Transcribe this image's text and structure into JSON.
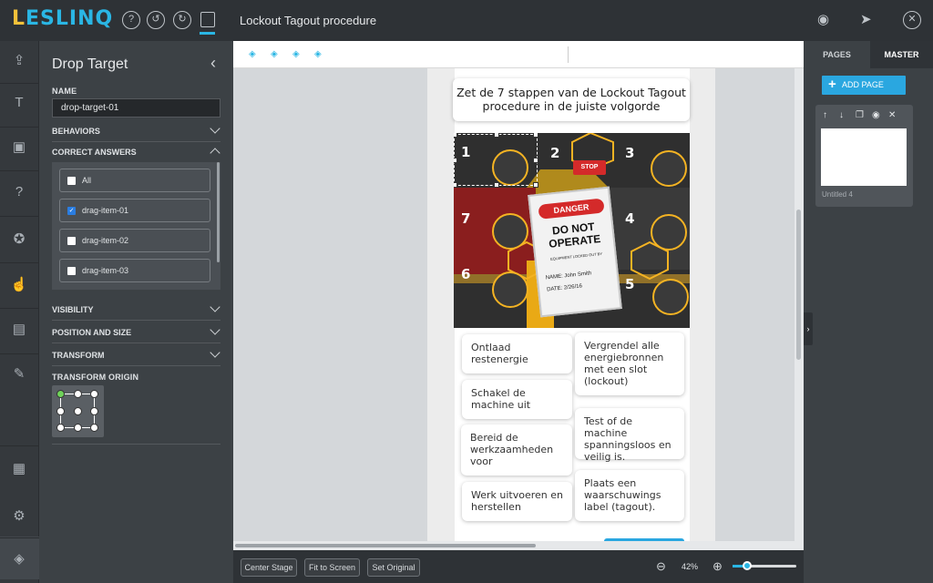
{
  "app": {
    "logo": "LESLINQ",
    "title": "Lockout Tagout procedure"
  },
  "colors": {
    "accent": "#2ab6e4",
    "logo_yellow": "#f3c13a",
    "panel": "#3c4145",
    "topbar": "#2e3236"
  },
  "topbar_icons": [
    "help-icon",
    "undo-icon",
    "redo-icon",
    "save-icon",
    "preview-icon",
    "publish-icon",
    "close-icon"
  ],
  "leftrail_icons": [
    "upload-icon",
    "text-icon",
    "media-icon",
    "question-icon",
    "shape-icon",
    "interaction-icon",
    "gallery-icon",
    "edit-icon",
    "pages-icon",
    "settings-icon",
    "layers-icon"
  ],
  "props": {
    "title": "Drop Target",
    "name_label": "NAME",
    "name_value": "drop-target-01",
    "behaviors": "BEHAVIORS",
    "correct_answers": "CORRECT ANSWERS",
    "answers": [
      {
        "label": "All",
        "checked": false
      },
      {
        "label": "drag-item-01",
        "checked": true
      },
      {
        "label": "drag-item-02",
        "checked": false
      },
      {
        "label": "drag-item-03",
        "checked": false
      }
    ],
    "visibility": "VISIBILITY",
    "position_size": "POSITION AND SIZE",
    "transform": "TRANSFORM",
    "transform_origin": "TRANSFORM ORIGIN"
  },
  "stage": {
    "question": "Zet de 7 stappen van de Lockout Tagout procedure in de juiste volgorde",
    "image": {
      "numbers": [
        "1",
        "2",
        "3",
        "4",
        "5",
        "6",
        "7"
      ],
      "stop_sign": "STOP",
      "tag_danger": "DANGER",
      "tag_main": "DO NOT OPERATE",
      "tag_small": "EQUIPMENT LOCKED OUT BY",
      "tag_name": "NAME: John Smith",
      "tag_date": "DATE: 2/26/16"
    },
    "chips": [
      "Ontlaad restenergie",
      "Vergrendel alle energiebronnen met een slot (lockout)",
      "Schakel de machine uit",
      "Test of de machine spanningsloos en veilig is.",
      "Bereid de werkzaamheden voor",
      "Plaats een waarschuwings label (tagout).",
      "Werk uitvoeren en herstellen"
    ]
  },
  "bottom": {
    "center_stage": "Center Stage",
    "fit_screen": "Fit to Screen",
    "set_original": "Set Original",
    "zoom": "42%",
    "zoom_level": 0.42
  },
  "right": {
    "tab_pages": "PAGES",
    "tab_master": "MASTER",
    "add_page": "ADD PAGE",
    "page_label": "Untitled 4"
  }
}
